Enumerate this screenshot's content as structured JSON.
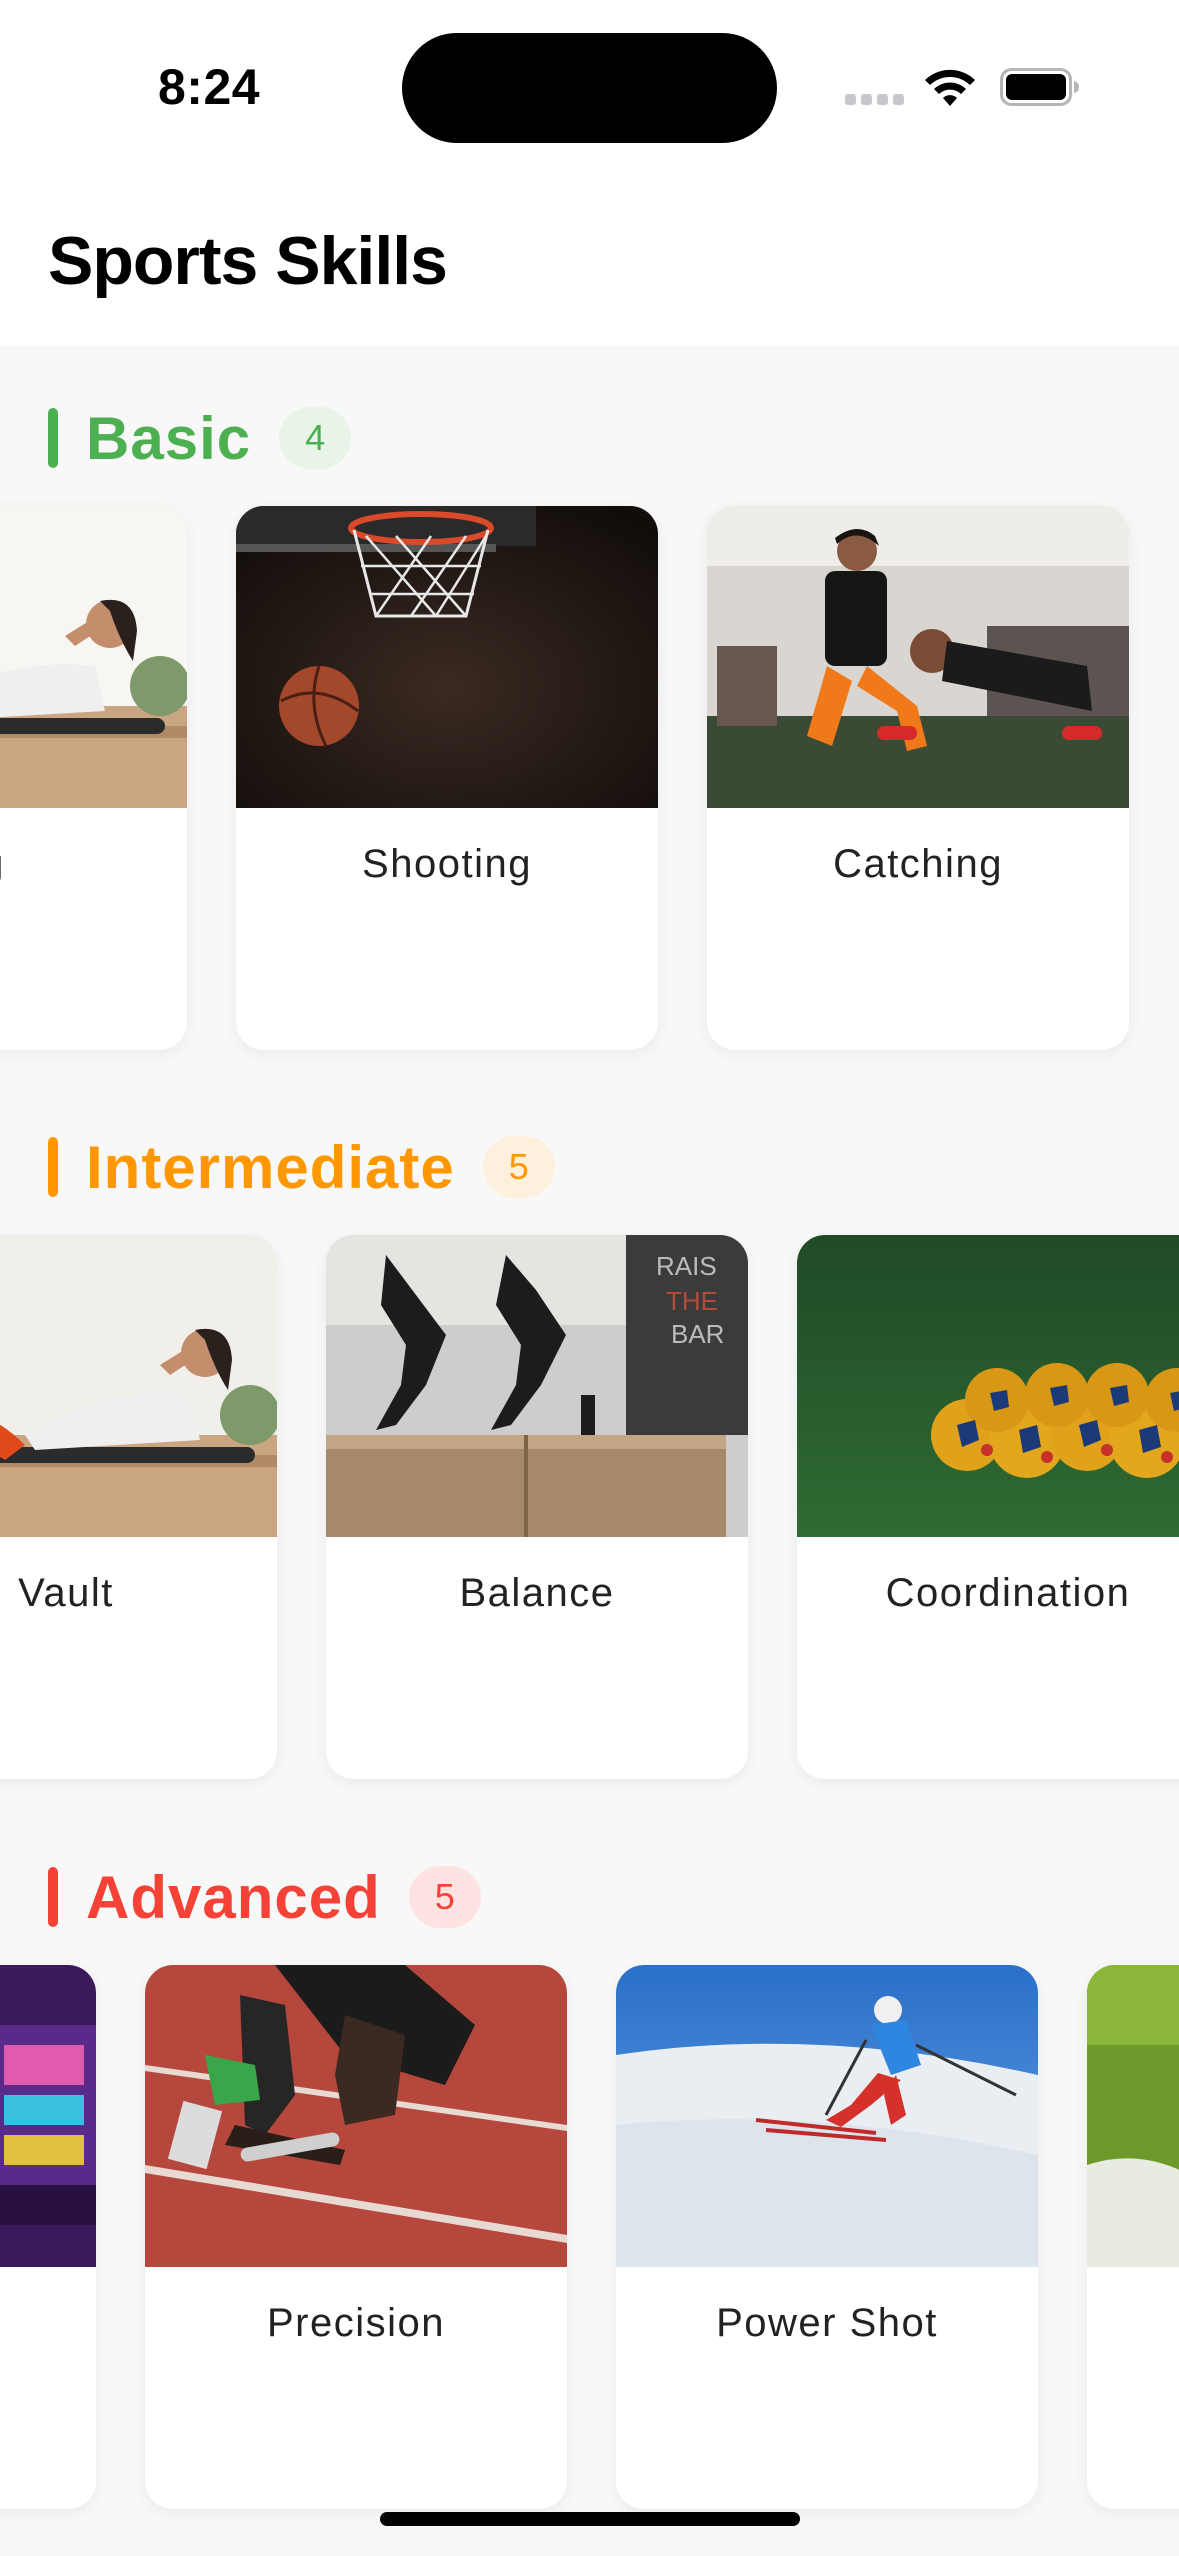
{
  "status_bar": {
    "time": "8:24"
  },
  "header": {
    "title": "Sports Skills"
  },
  "sections": [
    {
      "title": "Basic",
      "count": "4",
      "color": "#4caf50",
      "badge_bg": "#e7f4e7",
      "cards": [
        {
          "label": "ing",
          "image": "sit-up-icon"
        },
        {
          "label": "Shooting",
          "image": "basketball-hoop-icon"
        },
        {
          "label": "Catching",
          "image": "push-up-training-icon"
        }
      ]
    },
    {
      "title": "Intermediate",
      "count": "5",
      "color": "#ff9800",
      "badge_bg": "#fdf0dc",
      "cards": [
        {
          "label": "Vault",
          "image": "sit-up-icon"
        },
        {
          "label": "Balance",
          "image": "box-jump-icon"
        },
        {
          "label": "Coordination",
          "image": "soccer-balls-icon"
        }
      ]
    },
    {
      "title": "Advanced",
      "count": "5",
      "color": "#f44336",
      "badge_bg": "#fde3e1",
      "cards": [
        {
          "label": "",
          "image": "arcade-icon"
        },
        {
          "label": "Precision",
          "image": "sprint-start-icon"
        },
        {
          "label": "Power Shot",
          "image": "skier-icon"
        },
        {
          "label": "",
          "image": "grass-field-icon"
        }
      ]
    }
  ]
}
